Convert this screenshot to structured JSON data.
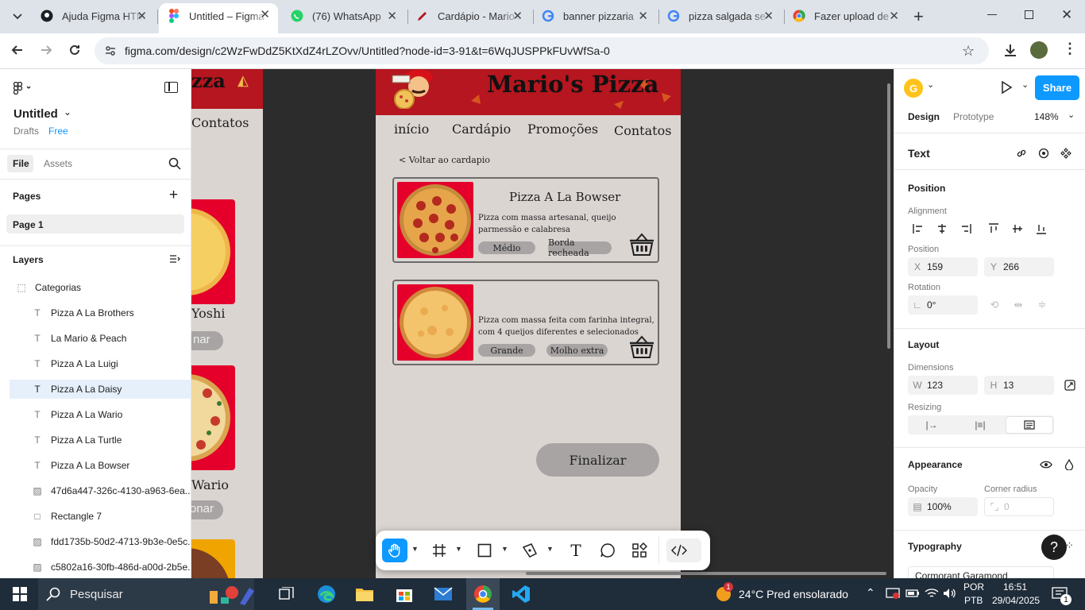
{
  "browser": {
    "tabs": [
      {
        "title": "Ajuda Figma HTML",
        "favicon": "github-icon"
      },
      {
        "title": "Untitled – Figma",
        "favicon": "figma-icon",
        "active": true
      },
      {
        "title": "(76) WhatsApp",
        "favicon": "whatsapp-icon"
      },
      {
        "title": "Cardápio - Mario's",
        "favicon": "pen-icon"
      },
      {
        "title": "banner pizzaria",
        "favicon": "google-icon"
      },
      {
        "title": "pizza salgada se",
        "favicon": "google-icon"
      },
      {
        "title": "Fazer upload de",
        "favicon": "chrome-icon"
      }
    ],
    "url": "figma.com/design/c2WzFwDdZ5KtXdZ4rLZOvv/Untitled?node-id=3-91&t=6WqJUSPPkFUvWfSa-0"
  },
  "left_panel": {
    "file_name": "Untitled",
    "drafts": "Drafts",
    "plan": "Free",
    "tabs": [
      "File",
      "Assets"
    ],
    "pages_heading": "Pages",
    "page": "Page 1",
    "layers_heading": "Layers",
    "layers": [
      {
        "name": "Categorias",
        "type": "frame"
      },
      {
        "name": "Pizza A La Brothers",
        "type": "text"
      },
      {
        "name": "La Mario & Peach",
        "type": "text"
      },
      {
        "name": "Pizza A La Luigi",
        "type": "text"
      },
      {
        "name": "Pizza A La Daisy",
        "type": "text",
        "selected": true
      },
      {
        "name": "Pizza A La Wario",
        "type": "text"
      },
      {
        "name": "Pizza A La Turtle",
        "type": "text"
      },
      {
        "name": "Pizza A La Bowser",
        "type": "text"
      },
      {
        "name": "47d6a447-326c-4130-a963-6ea...",
        "type": "image"
      },
      {
        "name": "Rectangle 7",
        "type": "rectangle"
      },
      {
        "name": "fdd1735b-50d2-4713-9b3e-0e5c...",
        "type": "image"
      },
      {
        "name": "c5802a16-30fb-486d-a00d-2b5e...",
        "type": "image"
      }
    ]
  },
  "canvas": {
    "left_frame": {
      "header_fragment": "zza",
      "nav_fragment": "Contatos",
      "label1": "Yoshi",
      "btn1": "nar",
      "label2": "Wario",
      "btn2": "onar"
    },
    "main_frame": {
      "brand": "Mario's Pizza",
      "nav": [
        "início",
        "Cardápio",
        "Promoções",
        "Contatos"
      ],
      "back_link": "< Voltar ao cardapio",
      "items": [
        {
          "title": "Pizza A La Bowser",
          "description": "Pizza com massa artesanal, queijo parmessão e calabresa",
          "size": "Médio",
          "extra": "Borda recheada"
        },
        {
          "title": "",
          "description": "Pizza com massa feita com farinha integral, com 4 queijos diferentes e selecionados",
          "size": "Grande",
          "extra": "Molho extra"
        }
      ],
      "finish_button": "Finalizar"
    }
  },
  "right_panel": {
    "avatar_letter": "G",
    "share": "Share",
    "tabs": [
      "Design",
      "Prototype"
    ],
    "zoom": "148%",
    "element_type": "Text",
    "position_heading": "Position",
    "alignment_label": "Alignment",
    "position_label": "Position",
    "x_key": "X",
    "x": "159",
    "y_key": "Y",
    "y": "266",
    "rotation_label": "Rotation",
    "rotation": "0°",
    "layout_heading": "Layout",
    "dimensions_label": "Dimensions",
    "w_key": "W",
    "w": "123",
    "h_key": "H",
    "h": "13",
    "resizing_label": "Resizing",
    "appearance_heading": "Appearance",
    "opacity_label": "Opacity",
    "opacity": "100%",
    "radius_label": "Corner radius",
    "radius": "0",
    "typography_heading": "Typography",
    "font": "Cormorant Garamond"
  },
  "taskbar": {
    "search": "Pesquisar",
    "weather_badge": "1",
    "weather": "24°C  Pred ensolarado",
    "lang1": "POR",
    "lang2": "PTB",
    "time": "16:51",
    "date": "29/04/2025",
    "notifications": "1"
  },
  "colors": {
    "header_red": "#b5161f",
    "pizza_bg": "#e4002b",
    "frame_bg": "#dbd5d2",
    "figma_blue": "#0d99ff",
    "canvas_bg": "#2c2c2c"
  }
}
